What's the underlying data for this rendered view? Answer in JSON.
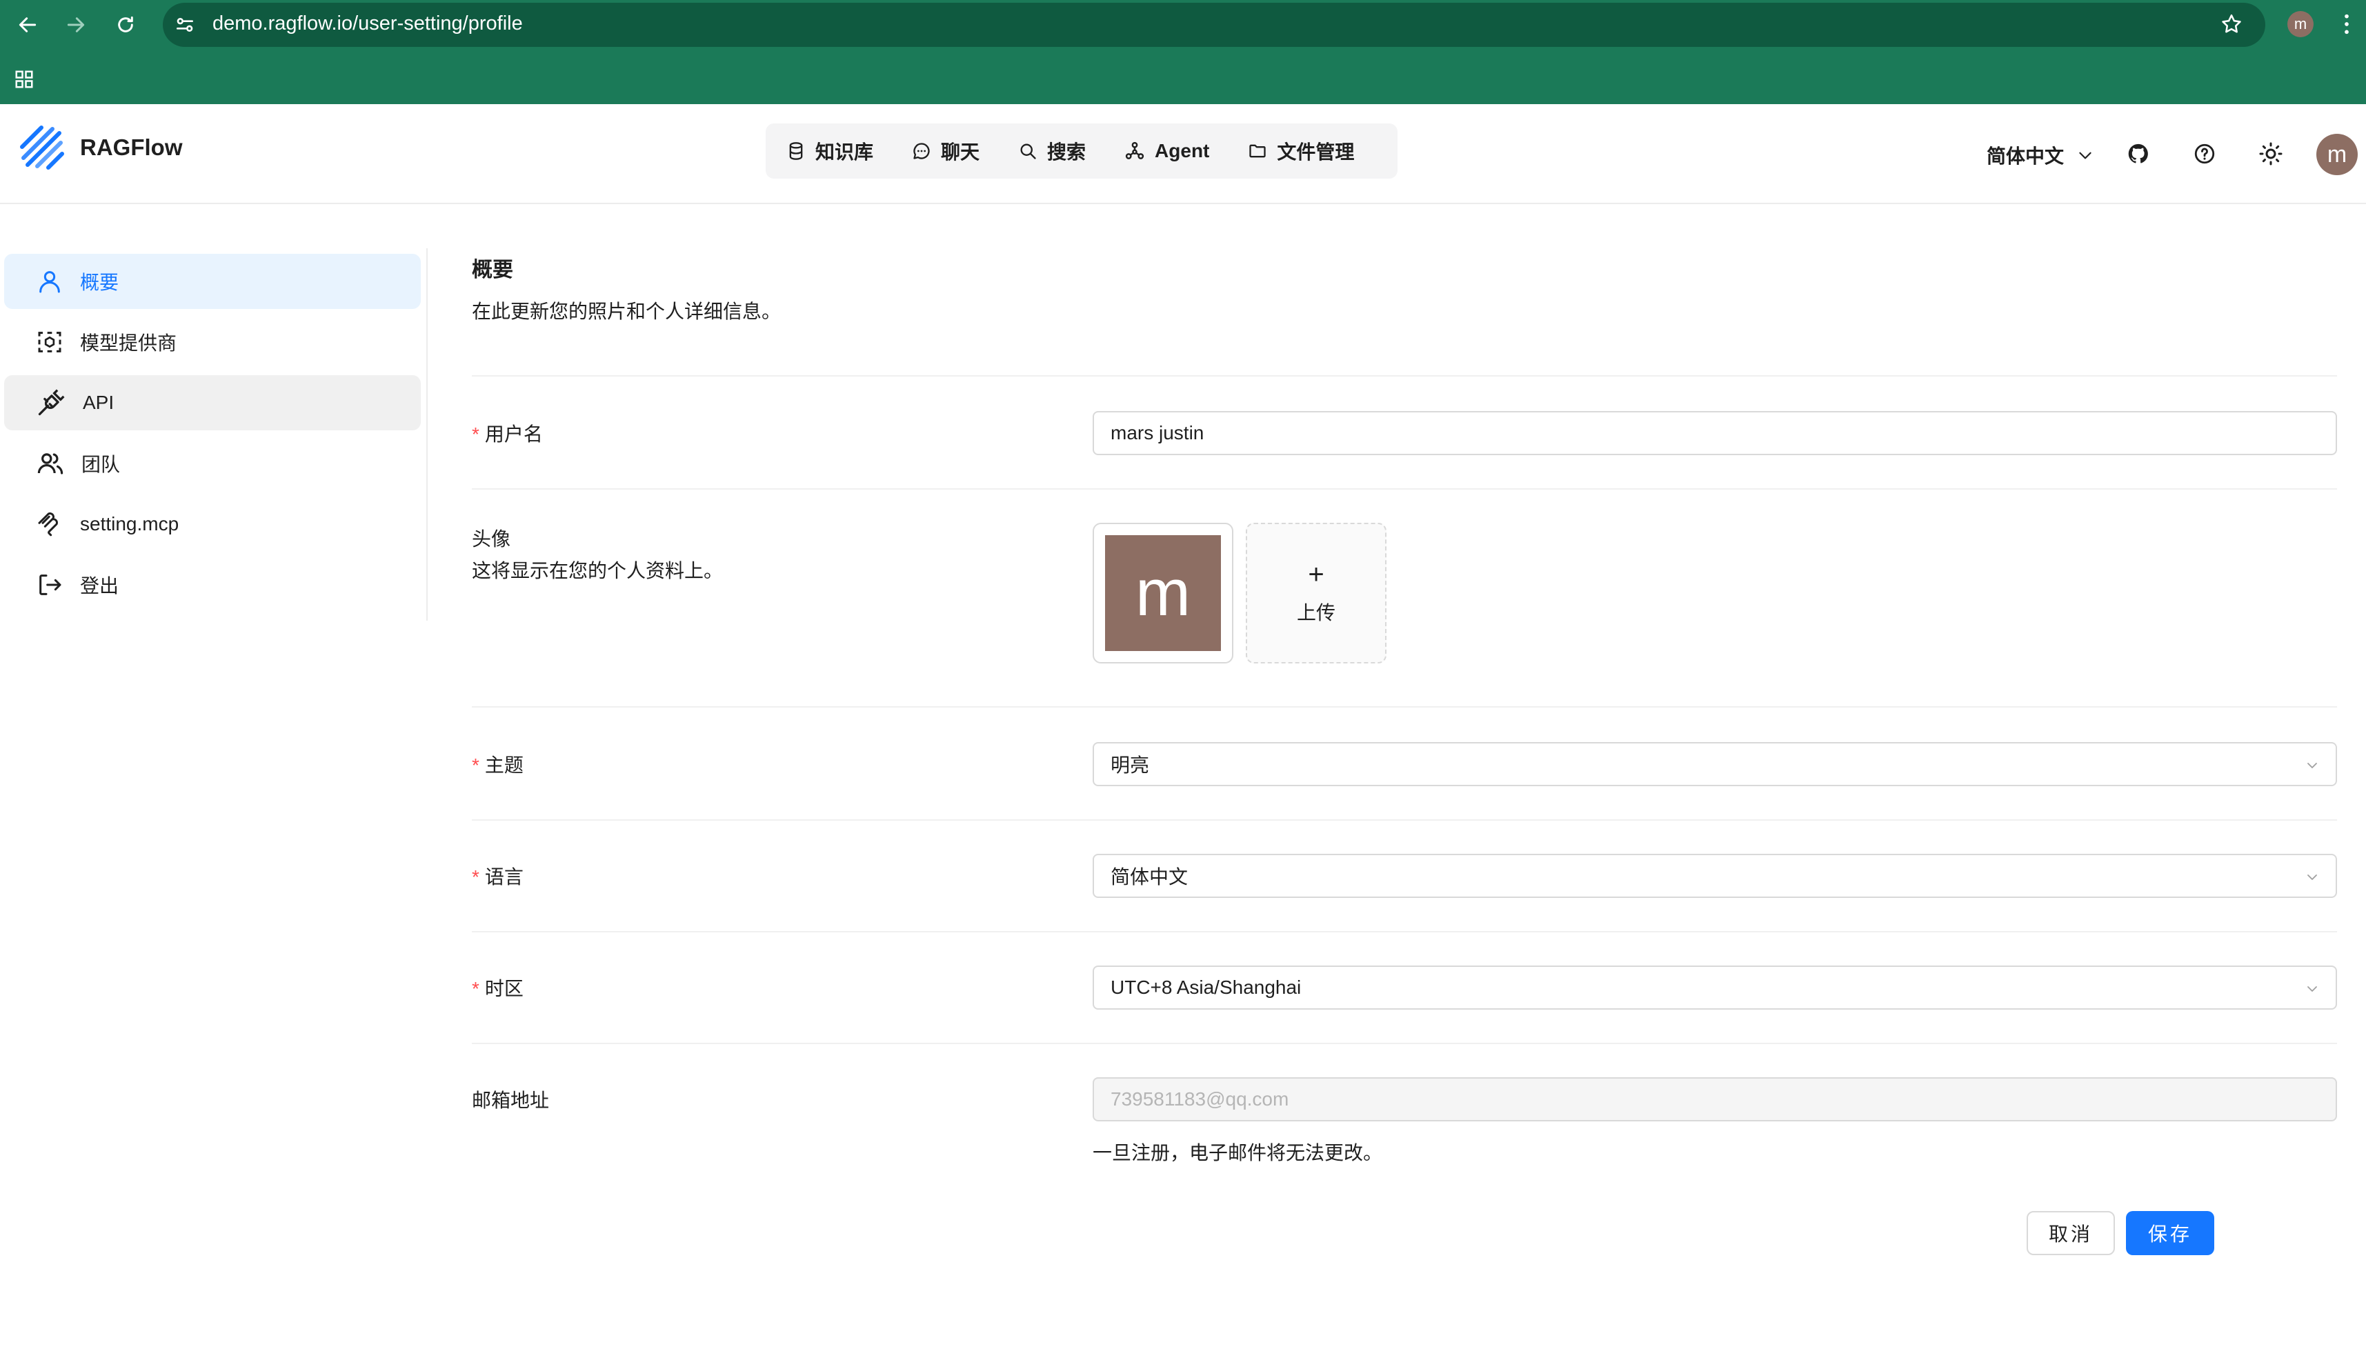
{
  "browser": {
    "url": "demo.ragflow.io/user-setting/profile",
    "profile_initial": "m"
  },
  "app": {
    "name": "RAGFlow",
    "nav": [
      {
        "label": "知识库",
        "icon": "database-icon"
      },
      {
        "label": "聊天",
        "icon": "chat-bubble-icon"
      },
      {
        "label": "搜索",
        "icon": "search-icon"
      },
      {
        "label": "Agent",
        "icon": "agent-graph-icon"
      },
      {
        "label": "文件管理",
        "icon": "folder-icon"
      }
    ],
    "language_label": "简体中文",
    "user_initial": "m"
  },
  "sidebar": {
    "items": [
      {
        "label": "概要",
        "icon": "user-icon",
        "active": true
      },
      {
        "label": "模型提供商",
        "icon": "model-box-icon"
      },
      {
        "label": "API",
        "icon": "plug-icon"
      },
      {
        "label": "团队",
        "icon": "team-icon"
      },
      {
        "label": "setting.mcp",
        "icon": "mcp-icon"
      },
      {
        "label": "登出",
        "icon": "logout-icon"
      }
    ]
  },
  "profile": {
    "title": "概要",
    "subtitle": "在此更新您的照片和个人详细信息。",
    "username": {
      "label": "用户名",
      "value": "mars justin"
    },
    "avatar": {
      "label": "头像",
      "desc": "这将显示在您的个人资料上。",
      "initial": "m",
      "upload_label": "上传",
      "upload_plus": "+"
    },
    "theme": {
      "label": "主题",
      "value": "明亮"
    },
    "language": {
      "label": "语言",
      "value": "简体中文"
    },
    "timezone": {
      "label": "时区",
      "value": "UTC+8 Asia/Shanghai"
    },
    "email": {
      "label": "邮箱地址",
      "value": "739581183@qq.com",
      "hint": "一旦注册，电子邮件将无法更改。"
    },
    "required_mark": "*",
    "cancel_label": "取消",
    "save_label": "保存"
  },
  "colors": {
    "browser_bar": "#1b7a58",
    "accent": "#1677ff",
    "avatar_bg": "#8d6e63",
    "required": "#ff4d4f"
  }
}
